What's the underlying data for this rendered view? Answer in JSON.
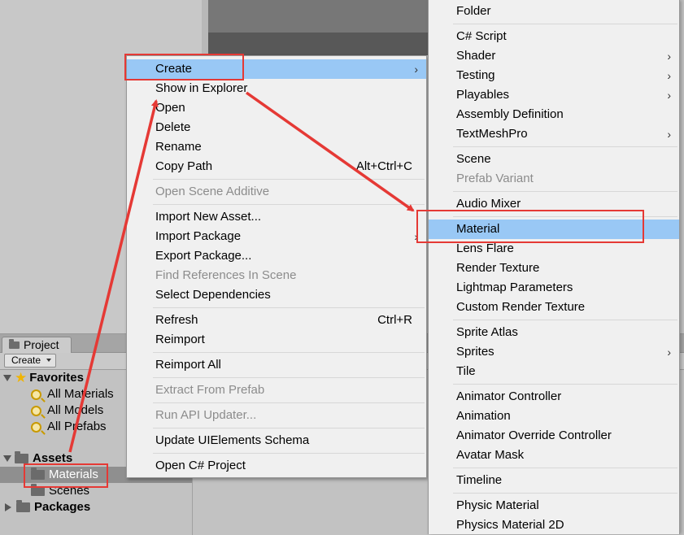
{
  "project_window": {
    "tab_label": "Project",
    "create_button": "Create",
    "favorites": {
      "label": "Favorites",
      "items": [
        "All Materials",
        "All Models",
        "All Prefabs"
      ]
    },
    "assets": {
      "label": "Assets",
      "children": [
        "Materials",
        "Scenes"
      ]
    },
    "packages": {
      "label": "Packages"
    }
  },
  "context_menu": {
    "items": [
      {
        "label": "Create",
        "has_submenu": true,
        "highlighted": true
      },
      {
        "label": "Show in Explorer"
      },
      {
        "label": "Open"
      },
      {
        "label": "Delete"
      },
      {
        "label": "Rename"
      },
      {
        "label": "Copy Path",
        "shortcut": "Alt+Ctrl+C"
      },
      {
        "label": "Open Scene Additive",
        "disabled": true
      },
      {
        "label": "Import New Asset..."
      },
      {
        "label": "Import Package",
        "has_submenu": true
      },
      {
        "label": "Export Package..."
      },
      {
        "label": "Find References In Scene",
        "disabled": true
      },
      {
        "label": "Select Dependencies"
      },
      {
        "label": "Refresh",
        "shortcut": "Ctrl+R"
      },
      {
        "label": "Reimport"
      },
      {
        "label": "Reimport All"
      },
      {
        "label": "Extract From Prefab",
        "disabled": true
      },
      {
        "label": "Run API Updater...",
        "disabled": true
      },
      {
        "label": "Update UIElements Schema"
      },
      {
        "label": "Open C# Project"
      }
    ]
  },
  "create_submenu": {
    "items": [
      {
        "label": "Folder"
      },
      {
        "label": "C# Script"
      },
      {
        "label": "Shader",
        "has_submenu": true
      },
      {
        "label": "Testing",
        "has_submenu": true
      },
      {
        "label": "Playables",
        "has_submenu": true
      },
      {
        "label": "Assembly Definition"
      },
      {
        "label": "TextMeshPro",
        "has_submenu": true
      },
      {
        "label": "Scene"
      },
      {
        "label": "Prefab Variant",
        "disabled": true
      },
      {
        "label": "Audio Mixer"
      },
      {
        "label": "Material",
        "highlighted": true
      },
      {
        "label": "Lens Flare"
      },
      {
        "label": "Render Texture"
      },
      {
        "label": "Lightmap Parameters"
      },
      {
        "label": "Custom Render Texture"
      },
      {
        "label": "Sprite Atlas"
      },
      {
        "label": "Sprites",
        "has_submenu": true
      },
      {
        "label": "Tile"
      },
      {
        "label": "Animator Controller"
      },
      {
        "label": "Animation"
      },
      {
        "label": "Animator Override Controller"
      },
      {
        "label": "Avatar Mask"
      },
      {
        "label": "Timeline"
      },
      {
        "label": "Physic Material"
      },
      {
        "label": "Physics Material 2D"
      }
    ]
  },
  "icons": {
    "submenu_arrow": "chevron-right-icon",
    "favorites": "star-icon",
    "search_filter": "magnifier-icon",
    "folder": "folder-icon"
  },
  "colors": {
    "menu_background": "#f0f0f0",
    "highlight": "#99c8f5",
    "disabled_text": "#8c8c8c",
    "annotation_red": "#e53935",
    "selected_row": "#8f8f8f"
  }
}
